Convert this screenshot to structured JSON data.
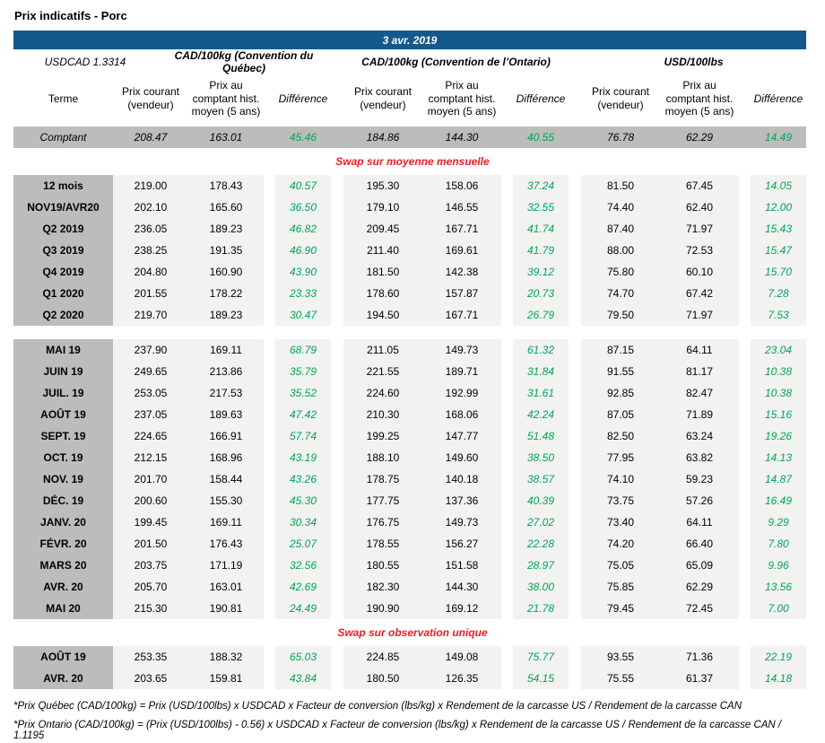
{
  "page_title": "Prix indicatifs - Porc",
  "banner": {
    "date": "3 avr. 2019"
  },
  "fx": {
    "label": "USDCAD 1.3314"
  },
  "group_headers": [
    "CAD/100kg (Convention du Québec)",
    "CAD/100kg (Convention de l’Ontario)",
    "USD/100lbs"
  ],
  "column_headers": {
    "terme": "Terme",
    "prix_courant": "Prix courant (vendeur)",
    "prix_comptant": "Prix au comptant hist. moyen (5 ans)",
    "difference": "Différence"
  },
  "colors": {
    "banner_blue": "#14598b",
    "label_gray": "#bcbcbc",
    "cell_gray": "#f2f2f2",
    "positive_green": "#00a651",
    "section_red": "#ee1c24"
  },
  "blocks": [
    {
      "kind": "spot_row",
      "row": {
        "terme": "Comptant",
        "values": [
          "208.47",
          "163.01",
          "45.46",
          "184.86",
          "144.30",
          "40.55",
          "76.78",
          "62.29",
          "14.49"
        ]
      }
    },
    {
      "kind": "section_title",
      "text": "Swap sur moyenne mensuelle"
    },
    {
      "kind": "rows",
      "rows": [
        {
          "terme": "12 mois",
          "values": [
            "219.00",
            "178.43",
            "40.57",
            "195.30",
            "158.06",
            "37.24",
            "81.50",
            "67.45",
            "14.05"
          ]
        },
        {
          "terme": "NOV19/AVR20",
          "values": [
            "202.10",
            "165.60",
            "36.50",
            "179.10",
            "146.55",
            "32.55",
            "74.40",
            "62.40",
            "12.00"
          ]
        },
        {
          "terme": "Q2 2019",
          "values": [
            "236.05",
            "189.23",
            "46.82",
            "209.45",
            "167.71",
            "41.74",
            "87.40",
            "71.97",
            "15.43"
          ]
        },
        {
          "terme": "Q3 2019",
          "values": [
            "238.25",
            "191.35",
            "46.90",
            "211.40",
            "169.61",
            "41.79",
            "88.00",
            "72.53",
            "15.47"
          ]
        },
        {
          "terme": "Q4 2019",
          "values": [
            "204.80",
            "160.90",
            "43.90",
            "181.50",
            "142.38",
            "39.12",
            "75.80",
            "60.10",
            "15.70"
          ]
        },
        {
          "terme": "Q1 2020",
          "values": [
            "201.55",
            "178.22",
            "23.33",
            "178.60",
            "157.87",
            "20.73",
            "74.70",
            "67.42",
            "7.28"
          ]
        },
        {
          "terme": "Q2 2020",
          "values": [
            "219.70",
            "189.23",
            "30.47",
            "194.50",
            "167.71",
            "26.79",
            "79.50",
            "71.97",
            "7.53"
          ]
        }
      ]
    },
    {
      "kind": "spacer"
    },
    {
      "kind": "rows",
      "rows": [
        {
          "terme": "MAI 19",
          "values": [
            "237.90",
            "169.11",
            "68.79",
            "211.05",
            "149.73",
            "61.32",
            "87.15",
            "64.11",
            "23.04"
          ]
        },
        {
          "terme": "JUIN 19",
          "values": [
            "249.65",
            "213.86",
            "35.79",
            "221.55",
            "189.71",
            "31.84",
            "91.55",
            "81.17",
            "10.38"
          ]
        },
        {
          "terme": "JUIL. 19",
          "values": [
            "253.05",
            "217.53",
            "35.52",
            "224.60",
            "192.99",
            "31.61",
            "92.85",
            "82.47",
            "10.38"
          ]
        },
        {
          "terme": "AOÛT 19",
          "values": [
            "237.05",
            "189.63",
            "47.42",
            "210.30",
            "168.06",
            "42.24",
            "87.05",
            "71.89",
            "15.16"
          ]
        },
        {
          "terme": "SEPT. 19",
          "values": [
            "224.65",
            "166.91",
            "57.74",
            "199.25",
            "147.77",
            "51.48",
            "82.50",
            "63.24",
            "19.26"
          ]
        },
        {
          "terme": "OCT. 19",
          "values": [
            "212.15",
            "168.96",
            "43.19",
            "188.10",
            "149.60",
            "38.50",
            "77.95",
            "63.82",
            "14.13"
          ]
        },
        {
          "terme": "NOV. 19",
          "values": [
            "201.70",
            "158.44",
            "43.26",
            "178.75",
            "140.18",
            "38.57",
            "74.10",
            "59.23",
            "14.87"
          ]
        },
        {
          "terme": "DÉC. 19",
          "values": [
            "200.60",
            "155.30",
            "45.30",
            "177.75",
            "137.36",
            "40.39",
            "73.75",
            "57.26",
            "16.49"
          ]
        },
        {
          "terme": "JANV. 20",
          "values": [
            "199.45",
            "169.11",
            "30.34",
            "176.75",
            "149.73",
            "27.02",
            "73.40",
            "64.11",
            "9.29"
          ]
        },
        {
          "terme": "FÉVR. 20",
          "values": [
            "201.50",
            "176.43",
            "25.07",
            "178.55",
            "156.27",
            "22.28",
            "74.20",
            "66.40",
            "7.80"
          ]
        },
        {
          "terme": "MARS 20",
          "values": [
            "203.75",
            "171.19",
            "32.56",
            "180.55",
            "151.58",
            "28.97",
            "75.05",
            "65.09",
            "9.96"
          ]
        },
        {
          "terme": "AVR. 20",
          "values": [
            "205.70",
            "163.01",
            "42.69",
            "182.30",
            "144.30",
            "38.00",
            "75.85",
            "62.29",
            "13.56"
          ]
        },
        {
          "terme": "MAI 20",
          "values": [
            "215.30",
            "190.81",
            "24.49",
            "190.90",
            "169.12",
            "21.78",
            "79.45",
            "72.45",
            "7.00"
          ]
        }
      ]
    },
    {
      "kind": "section_title",
      "text": "Swap sur observation unique"
    },
    {
      "kind": "rows",
      "rows": [
        {
          "terme": "AOÛT 19",
          "values": [
            "253.35",
            "188.32",
            "65.03",
            "224.85",
            "149.08",
            "75.77",
            "93.55",
            "71.36",
            "22.19"
          ]
        },
        {
          "terme": "AVR. 20",
          "values": [
            "203.65",
            "159.81",
            "43.84",
            "180.50",
            "126.35",
            "54.15",
            "75.55",
            "61.37",
            "14.18"
          ]
        }
      ]
    },
    {
      "kind": "footnotes"
    }
  ],
  "footnotes": [
    "*Prix Québec (CAD/100kg) = Prix (USD/100lbs) x USDCAD x Facteur de conversion (lbs/kg) x Rendement de la carcasse US / Rendement de la carcasse CAN",
    "*Prix Ontario (CAD/100kg) = (Prix (USD/100lbs) - 0.56) x USDCAD x Facteur de conversion (lbs/kg) x Rendement de la carcasse US / Rendement de la carcasse CAN / 1.1195"
  ]
}
